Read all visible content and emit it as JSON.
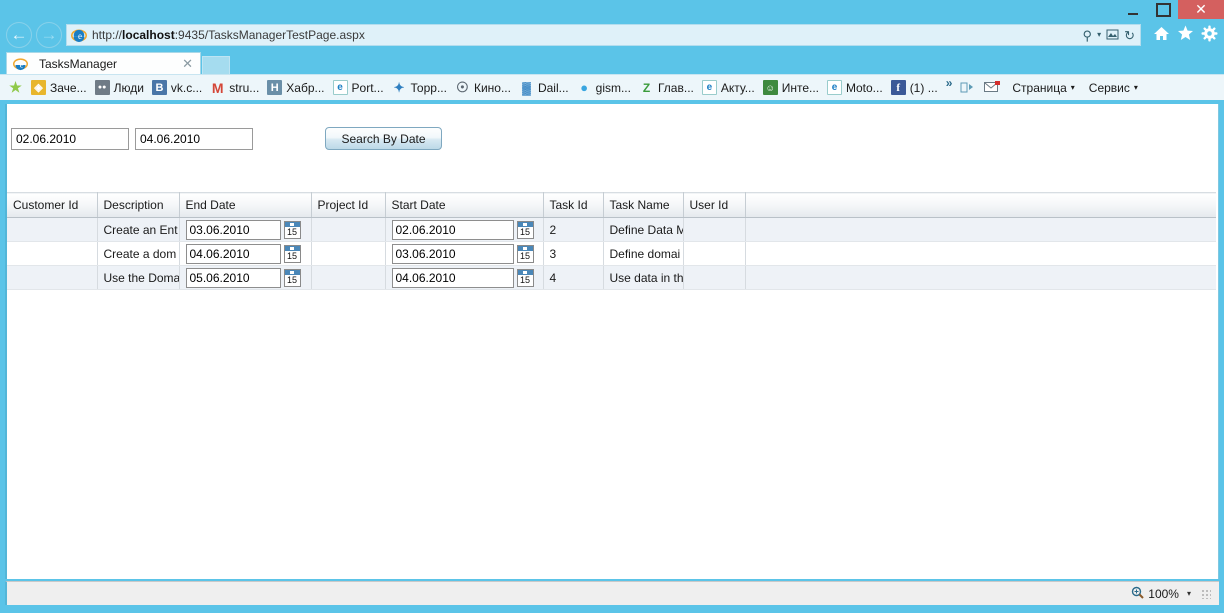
{
  "window": {
    "minimize_label": "",
    "maximize_label": "",
    "close_label": "✕"
  },
  "navigation": {
    "back_icon": "←",
    "forward_icon": "→",
    "url_prefix": "http://",
    "url_host": "localhost",
    "url_rest": ":9435/TasksManagerTestPage.aspx",
    "search_icon": "⚲",
    "search_caret": "▾",
    "compat_icon": "☷",
    "refresh_icon": "↻",
    "home_icon": "⌂",
    "favorites_icon": "★",
    "tools_icon": "⚙"
  },
  "tabs": [
    {
      "title": "TasksManager",
      "close_label": "✕"
    }
  ],
  "new_tab_label": "",
  "favorites": {
    "add_icon": "☆",
    "items": [
      {
        "label": "Заче...",
        "icon_text": "◈",
        "icon_bg": "#e8b62c"
      },
      {
        "label": "Люди",
        "icon_text": "●●",
        "icon_bg": "#6f7b86"
      },
      {
        "label": "vk.c...",
        "icon_text": "B",
        "icon_bg": "#4a76a8"
      },
      {
        "label": "stru...",
        "icon_text": "M",
        "icon_bg": "#d44638"
      },
      {
        "label": "Хабр...",
        "icon_text": "H",
        "icon_bg": "#6a8fa8"
      },
      {
        "label": "Port...",
        "icon_text": "e",
        "icon_bg": "#1a7dc4"
      },
      {
        "label": "Торр...",
        "icon_text": "✦",
        "icon_bg": "#2f7fc0"
      },
      {
        "label": "Кино...",
        "icon_text": "☉",
        "icon_bg": "#5b6670"
      },
      {
        "label": "Dail...",
        "icon_text": "▓",
        "icon_bg": "#2f7fc0"
      },
      {
        "label": "gism...",
        "icon_text": "●",
        "icon_bg": "#3aa6e0"
      },
      {
        "label": "Глав...",
        "icon_text": "Z",
        "icon_bg": "#3a9b3a"
      },
      {
        "label": "Акту...",
        "icon_text": "e",
        "icon_bg": "#1a7dc4"
      },
      {
        "label": "Инте...",
        "icon_text": "☺",
        "icon_bg": "#3f8a3f"
      },
      {
        "label": "Moto...",
        "icon_text": "e",
        "icon_bg": "#1a7dc4"
      },
      {
        "label": "(1) ...",
        "icon_text": "f",
        "icon_bg": "#3b5998"
      }
    ],
    "more_chevron": "»",
    "right_icons": [
      {
        "name": "reading-view-icon",
        "glyph": "◁⁅"
      },
      {
        "name": "mail-icon",
        "glyph": "✉"
      }
    ],
    "menus": [
      {
        "label": "Страница",
        "caret": "▾"
      },
      {
        "label": "Сервис",
        "caret": "▾"
      }
    ]
  },
  "page": {
    "search_form": {
      "date_from_value": "02.06.2010",
      "date_from_placeholder": "",
      "date_to_value": "04.06.2010",
      "date_to_placeholder": "",
      "search_button_label": "Search By Date"
    },
    "grid": {
      "columns": [
        "Customer Id",
        "Description",
        "End Date",
        "Project Id",
        "Start Date",
        "Task Id",
        "Task Name",
        "User Id",
        ""
      ],
      "calendar_icon_day": "15",
      "rows": [
        {
          "customer_id": "",
          "description": "Create an Ent",
          "end_date": "03.06.2010",
          "project_id": "",
          "start_date": "02.06.2010",
          "task_id": "2",
          "task_name": "Define Data M",
          "user_id": "",
          "extra": ""
        },
        {
          "customer_id": "",
          "description": "Create a dom",
          "end_date": "04.06.2010",
          "project_id": "",
          "start_date": "03.06.2010",
          "task_id": "3",
          "task_name": "Define domai",
          "user_id": "",
          "extra": ""
        },
        {
          "customer_id": "",
          "description": "Use the Doma",
          "end_date": "05.06.2010",
          "project_id": "",
          "start_date": "04.06.2010",
          "task_id": "4",
          "task_name": "Use data in th",
          "user_id": "",
          "extra": ""
        }
      ]
    }
  },
  "status_bar": {
    "zoom_level": "100%",
    "zoom_caret": "▾"
  },
  "colors": {
    "chrome_blue": "#5bc4e8",
    "close_red": "#d4605f",
    "row_alt": "#eef2f7",
    "accent_border": "#53b6d8"
  }
}
